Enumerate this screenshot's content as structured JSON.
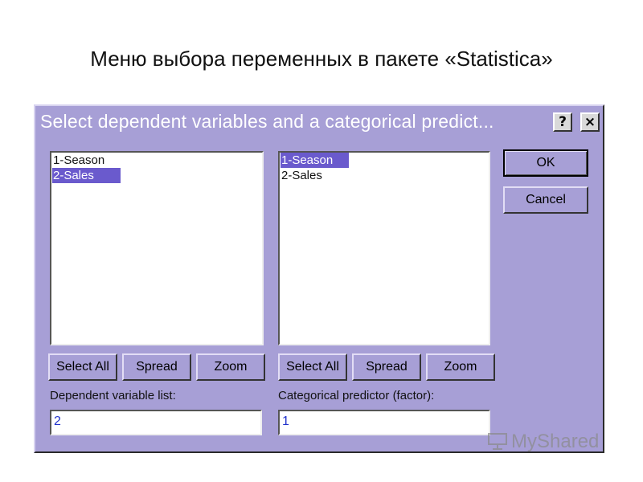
{
  "slide": {
    "title": "Меню выбора переменных в пакете «Statistica»"
  },
  "dialog": {
    "title": "Select dependent variables and a categorical predict...",
    "help_label": "?",
    "close_label": "×",
    "left_list": {
      "items": [
        {
          "label": "1-Season",
          "selected": false
        },
        {
          "label": "2-Sales",
          "selected": true
        }
      ],
      "buttons": {
        "select_all": "Select All",
        "spread": "Spread",
        "zoom": "Zoom"
      },
      "field_label": "Dependent variable list:",
      "field_value": "2"
    },
    "right_list": {
      "items": [
        {
          "label": "1-Season",
          "selected": true
        },
        {
          "label": "2-Sales",
          "selected": false
        }
      ],
      "buttons": {
        "select_all": "Select All",
        "spread": "Spread",
        "zoom": "Zoom"
      },
      "field_label": "Categorical predictor (factor):",
      "field_value": "1"
    },
    "ok_label": "OK",
    "cancel_label": "Cancel"
  },
  "watermark": {
    "text": "MyShared",
    "icon": "presentation-board-icon"
  },
  "colors": {
    "dialog_bg": "#a79fd6",
    "selection": "#6a5acd",
    "field_text": "#2233cc"
  }
}
